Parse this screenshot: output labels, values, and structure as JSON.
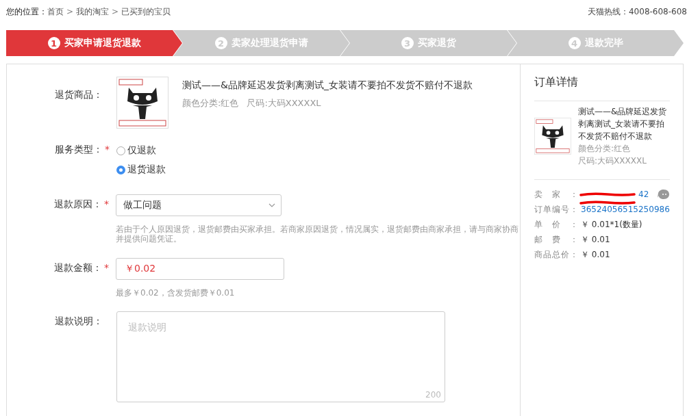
{
  "breadcrumb": {
    "label": "您的位置：",
    "crumbs": [
      {
        "kind": "link",
        "text": "首页"
      },
      {
        "kind": "separator",
        "text": ">"
      },
      {
        "kind": "link",
        "text": "我的淘宝"
      },
      {
        "kind": "separator",
        "text": ">"
      },
      {
        "kind": "link",
        "text": "已买到的宝贝"
      }
    ]
  },
  "hotline": "天猫热线：4008-608-608",
  "steps": [
    {
      "number": "1",
      "label": "买家申请退货退款",
      "selected": true
    },
    {
      "number": "2",
      "label": "卖家处理退货申请",
      "selected": false
    },
    {
      "number": "3",
      "label": "买家退货",
      "selected": false
    },
    {
      "number": "4",
      "label": "退款完毕",
      "selected": false
    }
  ],
  "form": [
    {
      "kind": "product",
      "label": "退货商品：",
      "title": "测试——&品牌延迟发货剥离测试_女装请不要拍不发货不赔付不退款",
      "specs": [
        "颜色分类:红色",
        "尺码:大码XXXXXL"
      ]
    },
    {
      "kind": "radio",
      "label": "服务类型：",
      "required_mark": "*",
      "options": [
        {
          "label": "仅退款",
          "selected": false
        },
        {
          "label": "退货退款",
          "selected": true
        }
      ]
    },
    {
      "kind": "select",
      "label": "退款原因：",
      "required_mark": "*",
      "value": "做工问题",
      "hint": "若由于个人原因退货，退货邮费由买家承担。若商家原因退货，情况属实，退货邮费由商家承担，请与商家协商并提供问题凭证。"
    },
    {
      "kind": "input",
      "label": "退款金额：",
      "required_mark": "*",
      "value": "￥0.02",
      "hint": "最多￥0.02，含发货邮费￥0.01"
    },
    {
      "kind": "textarea",
      "label": "退款说明：",
      "placeholder": "退款说明",
      "counter": "200"
    }
  ],
  "order_detail": {
    "title": "订单详情",
    "product": {
      "title": "测试——&品牌延迟发货剥离测试_女装请不要拍不发货不赔付不退款",
      "specs": [
        "颜色分类:红色",
        "尺码:大码XXXXXL"
      ]
    },
    "info": [
      {
        "kind": "link",
        "label": "卖家：",
        "value": "42",
        "redacted": true,
        "chat": true
      },
      {
        "kind": "link",
        "label": "订单编号：",
        "value": "36524056515250986",
        "redacted": true,
        "chat": false
      },
      {
        "kind": "text",
        "label": "单价：",
        "value": "￥ 0.01*1(数量)",
        "redacted": false,
        "chat": false
      },
      {
        "kind": "text",
        "label": "邮费：",
        "value": "￥ 0.01",
        "redacted": false,
        "chat": false
      },
      {
        "kind": "text",
        "label": "商品总价：",
        "value": "￥ 0.01",
        "redacted": false,
        "chat": false
      }
    ]
  }
}
